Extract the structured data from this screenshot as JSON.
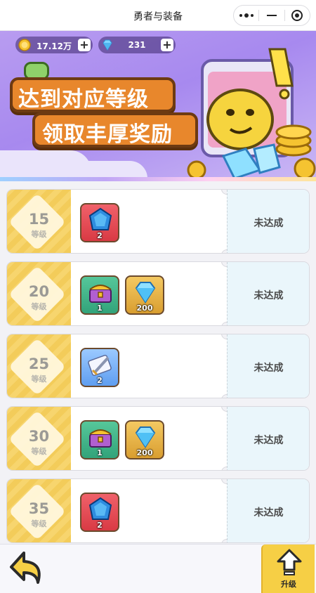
{
  "window": {
    "title": "勇者与装备"
  },
  "titlebar_icons": [
    "more-dots-icon",
    "minimize-icon",
    "close-target-icon"
  ],
  "currency": {
    "gold": {
      "value": "17.12万",
      "icon": "gold-coin-icon"
    },
    "diamond": {
      "value": "231",
      "icon": "diamond-icon"
    }
  },
  "banner": {
    "line1": "达到对应等级",
    "line2": "领取丰厚奖励"
  },
  "level_label": "等级",
  "status_label": "未达成",
  "rewards": [
    {
      "level": "15",
      "items": [
        {
          "icon": "blue-gem-icon",
          "count": "2",
          "bg": "red"
        }
      ]
    },
    {
      "level": "20",
      "items": [
        {
          "icon": "treasure-chest-icon",
          "count": "1",
          "bg": "green"
        },
        {
          "icon": "diamond-icon",
          "count": "200",
          "bg": "gold"
        }
      ]
    },
    {
      "level": "25",
      "items": [
        {
          "icon": "sword-scroll-icon",
          "count": "2",
          "bg": "blue"
        }
      ]
    },
    {
      "level": "30",
      "items": [
        {
          "icon": "treasure-chest-icon",
          "count": "1",
          "bg": "green"
        },
        {
          "icon": "diamond-icon",
          "count": "200",
          "bg": "gold"
        }
      ]
    },
    {
      "level": "35",
      "items": [
        {
          "icon": "blue-gem-icon",
          "count": "2",
          "bg": "red"
        }
      ]
    }
  ],
  "bottom": {
    "back_icon": "back-arrow-icon",
    "upgrade_label": "升级",
    "upgrade_icon": "upgrade-arrow-icon"
  },
  "colors": {
    "banner_purple": "#a789ef",
    "level_yellow": "#f7d56e",
    "status_bg": "#eaf6fb",
    "upgrade_yellow": "#f6cf45"
  }
}
